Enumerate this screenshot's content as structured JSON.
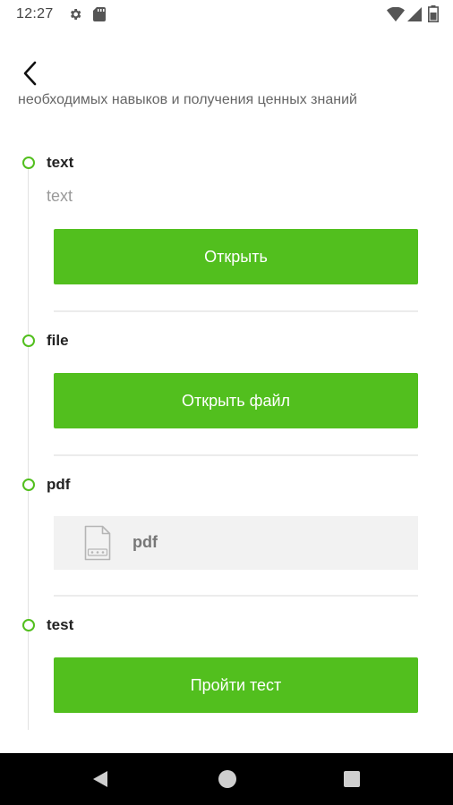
{
  "status_bar": {
    "time": "12:27",
    "icons": [
      "gear-icon",
      "sd-card-icon",
      "wifi-icon",
      "signal-icon",
      "battery-icon"
    ]
  },
  "header": {
    "back_icon": "chevron-left-icon"
  },
  "intro": {
    "text": "необходимых навыков и получения ценных знаний"
  },
  "items": [
    {
      "type": "text",
      "title": "text",
      "description": "text",
      "button_label": "Открыть"
    },
    {
      "type": "file",
      "title": "file",
      "button_label": "Открыть файл"
    },
    {
      "type": "pdf",
      "title": "pdf",
      "file_label": "pdf",
      "icon": "document-icon"
    },
    {
      "type": "test",
      "title": "test",
      "button_label": "Пройти тест"
    }
  ],
  "colors": {
    "accent": "#52bf1e",
    "divider": "#ececec",
    "card_bg": "#f2f2f2"
  },
  "nav_bar": {
    "icons": [
      "nav-back-icon",
      "nav-home-icon",
      "nav-recents-icon"
    ]
  }
}
